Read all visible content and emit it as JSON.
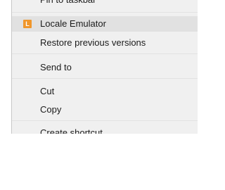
{
  "context_menu": {
    "items": [
      {
        "label": "Pin to taskbar"
      },
      {
        "label": "Locale Emulator",
        "icon": "locale-emulator-icon",
        "icon_letter": "L",
        "icon_color": "#f0962b",
        "highlighted": true
      },
      {
        "label": "Restore previous versions"
      },
      {
        "label": "Send to"
      },
      {
        "label": "Cut"
      },
      {
        "label": "Copy"
      },
      {
        "label": "Create shortcut"
      }
    ],
    "highlight_color": "#e1e1e1",
    "background_color": "#f0f0f0"
  }
}
